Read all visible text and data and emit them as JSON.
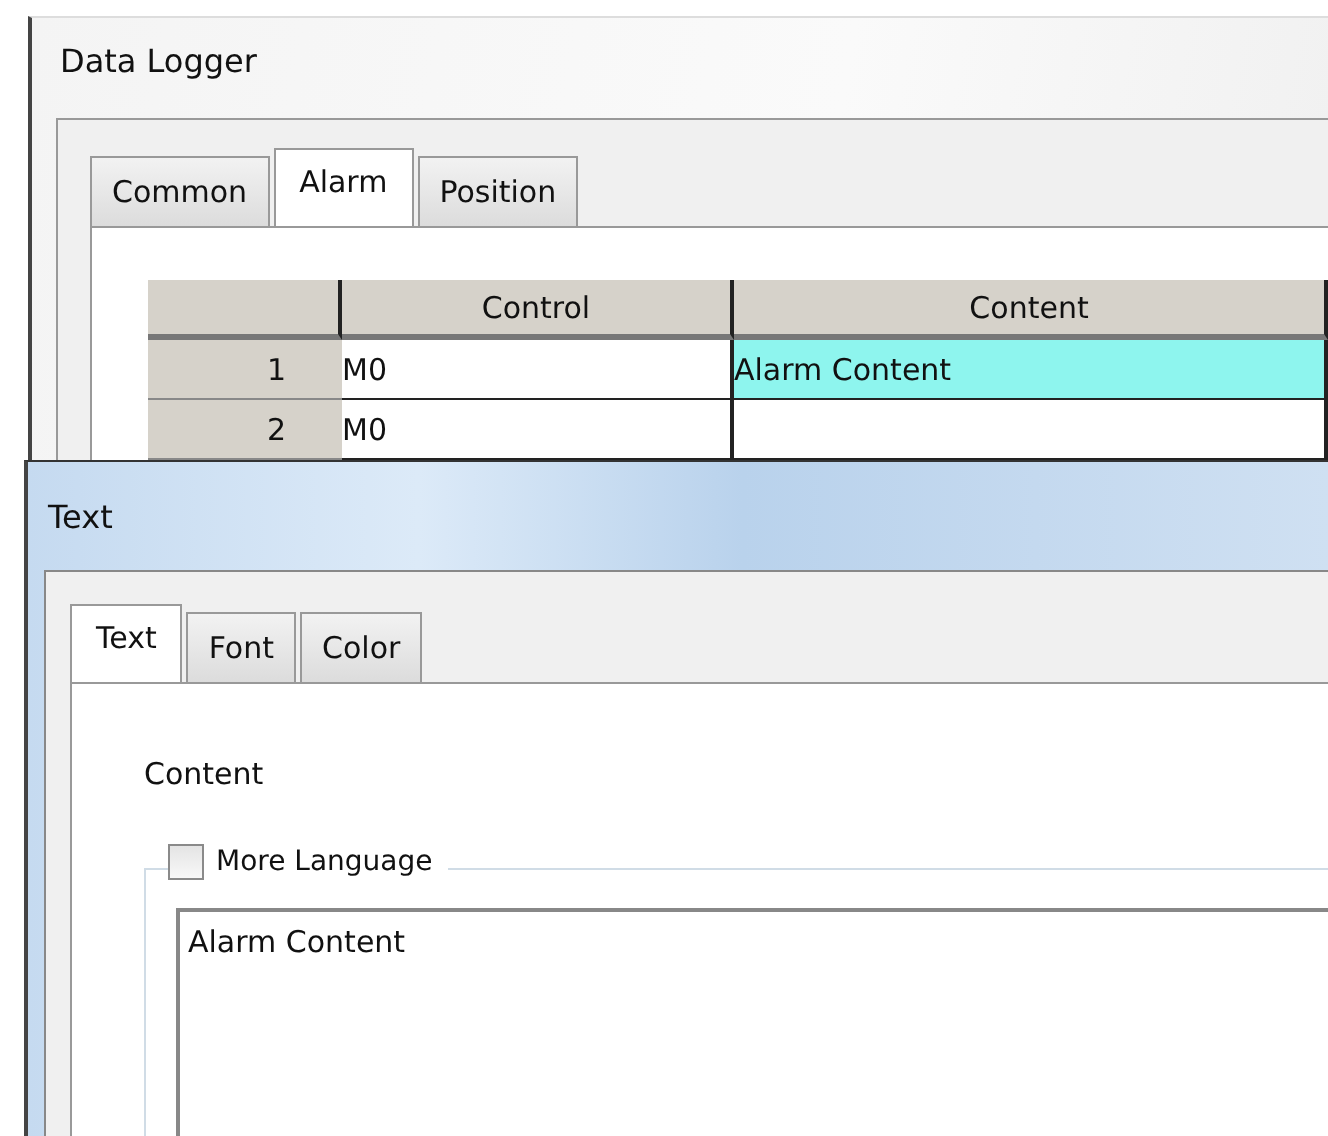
{
  "data_logger": {
    "title": "Data Logger",
    "tabs": [
      {
        "label": "Common",
        "selected": false
      },
      {
        "label": "Alarm",
        "selected": true
      },
      {
        "label": "Position",
        "selected": false
      }
    ],
    "table": {
      "columns": [
        "Control",
        "Content"
      ],
      "rows": [
        {
          "number": "1",
          "control": "M0",
          "content": "Alarm Content",
          "selected": true
        },
        {
          "number": "2",
          "control": "M0",
          "selected": false
        }
      ]
    }
  },
  "text_dialog": {
    "title": "Text",
    "tabs": [
      {
        "label": "Text",
        "selected": true
      },
      {
        "label": "Font",
        "selected": false
      },
      {
        "label": "Color",
        "selected": false
      }
    ],
    "content_label": "Content",
    "more_language": {
      "label": "More Language",
      "checked": false
    },
    "content_value": "Alarm Content"
  }
}
